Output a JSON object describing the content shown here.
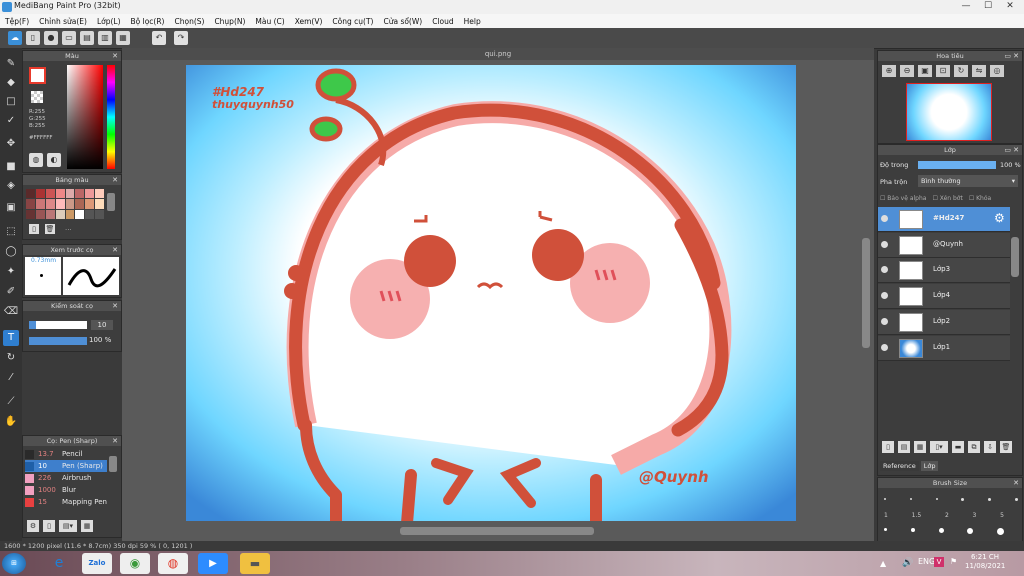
{
  "window": {
    "title": "MediBang Paint Pro (32bit)",
    "min": "—",
    "max": "☐",
    "close": "✕"
  },
  "menu": [
    "Tệp(F)",
    "Chỉnh sửa(E)",
    "Lớp(L)",
    "Bộ lọc(R)",
    "Chọn(S)",
    "Chụp(N)",
    "Màu (C)",
    "Xem(V)",
    "Công cụ(T)",
    "Cửa sổ(W)",
    "Cloud",
    "Help"
  ],
  "panels": {
    "color": {
      "title": "Màu",
      "r": "R:255",
      "g": "G:255",
      "b": "B:255",
      "hex": "#FFFFFF"
    },
    "palette": {
      "title": "Bảng màu",
      "dots": "..."
    },
    "preview": {
      "title": "Xem trước cọ",
      "size": "0.73mm"
    },
    "brush_control": {
      "title": "Kiểm soát cọ",
      "size": "10",
      "opacity": "100 %"
    },
    "brush": {
      "title": "Cọ: Pen (Sharp)",
      "items": [
        {
          "size": "13.7",
          "name": "Pencil",
          "color": "#2a2a2a"
        },
        {
          "size": "10",
          "name": "Pen (Sharp)",
          "color": "#1f5fa8",
          "selected": true
        },
        {
          "size": "226",
          "name": "Airbrush",
          "color": "#f2a0c0"
        },
        {
          "size": "1000",
          "name": "Blur",
          "color": "#f2a0c0"
        },
        {
          "size": "15",
          "name": "Mapping Pen",
          "color": "#e84040"
        }
      ]
    }
  },
  "document": {
    "tab": "qui.png"
  },
  "artwork": {
    "text1": "#Hd247",
    "text2": "thuyquynh50",
    "signature": "@Quynh"
  },
  "navigator": {
    "title": "Hoa tiêu"
  },
  "layers_panel": {
    "title": "Lớp",
    "opacity_label": "Độ trong",
    "opacity_value": "100 %",
    "blend_label": "Pha trộn",
    "blend_value": "Bình thường",
    "protect_alpha": "Bảo vệ alpha",
    "clipping": "Xén bớt",
    "lock": "Khóa",
    "layers": [
      {
        "name": "#Hd247",
        "selected": true
      },
      {
        "name": "@Quynh",
        "selected": false
      },
      {
        "name": "Lớp3",
        "selected": false
      },
      {
        "name": "Lớp4",
        "selected": false
      },
      {
        "name": "Lớp2",
        "selected": false
      },
      {
        "name": "Lớp1",
        "selected": false
      }
    ],
    "tabs": [
      "Reference",
      "Lớp"
    ]
  },
  "brush_size": {
    "title": "Brush Size",
    "values": [
      "1",
      "1.5",
      "2",
      "3",
      "5"
    ]
  },
  "status": {
    "text": "1600 * 1200 pixel   (11.6 * 8.7cm)  350 dpi   59 %   ( 0, 1201 )"
  },
  "taskbar": {
    "zalo": "Zalo",
    "time": "6:21 CH",
    "date": "11/08/2021"
  },
  "colors": {
    "accent": "#4f8fd6",
    "outline": "#d0503a",
    "sky": "#6fd6ff"
  }
}
